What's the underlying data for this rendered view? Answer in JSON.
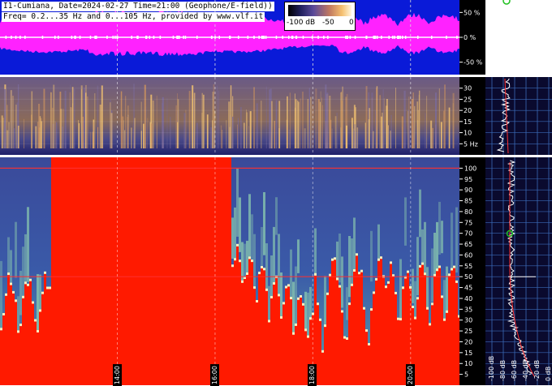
{
  "header": {
    "line1": "I1-Cumiana, Date=2024-02-27 Time=21:00 (Geophone/E-field))",
    "line2": "Freq= 0.2...35 Hz and 0...105 Hz, provided by www.vlf.it"
  },
  "colorbar": {
    "labels": [
      "-100 dB",
      "-50",
      "0"
    ]
  },
  "colors": {
    "waveform_fill": "#0a1ad8",
    "waveform_env": "#ff22ff",
    "saturated": "#ff1a00",
    "marker_line": "#ff3030"
  },
  "chart_data": [
    {
      "type": "area",
      "panel": "waveform",
      "y_ticks": [
        "50 %",
        "0 %",
        "-50 %"
      ],
      "y_values": [
        50,
        0,
        -50
      ],
      "ylim": [
        -75,
        75
      ]
    },
    {
      "type": "heatmap",
      "panel": "spectrogram-low",
      "ylabel": "Hz",
      "y_ticks": [
        "30",
        "25",
        "20",
        "15",
        "10",
        "5 Hz"
      ],
      "y_values": [
        30,
        25,
        20,
        15,
        10,
        5
      ],
      "ylim": [
        0,
        35
      ]
    },
    {
      "type": "heatmap",
      "panel": "spectrogram-high",
      "y_ticks": [
        "100",
        "95",
        "90",
        "85",
        "80",
        "75",
        "70",
        "65",
        "60",
        "55",
        "50",
        "45",
        "40",
        "35",
        "30",
        "25",
        "20",
        "15",
        "10",
        "5"
      ],
      "y_values": [
        100,
        95,
        90,
        85,
        80,
        75,
        70,
        65,
        60,
        55,
        50,
        45,
        40,
        35,
        30,
        25,
        20,
        15,
        10,
        5
      ],
      "ylim": [
        0,
        105
      ],
      "x_time_labels": [
        "14:00",
        "16:00",
        "18:00",
        "20:00"
      ],
      "x_time_hours": [
        14,
        16,
        18,
        20
      ],
      "xlim_hours": [
        11.6,
        21.0
      ],
      "marker_lines_hz": [
        100,
        50
      ]
    },
    {
      "type": "line",
      "panel": "mean-spectrum",
      "x_ticks": [
        "-100 dB",
        "-80 dB",
        "-60 dB",
        "-40 dB",
        "-20 dB",
        "0 dB"
      ],
      "x_values": [
        -100,
        -80,
        -60,
        -40,
        -20,
        0
      ]
    }
  ]
}
